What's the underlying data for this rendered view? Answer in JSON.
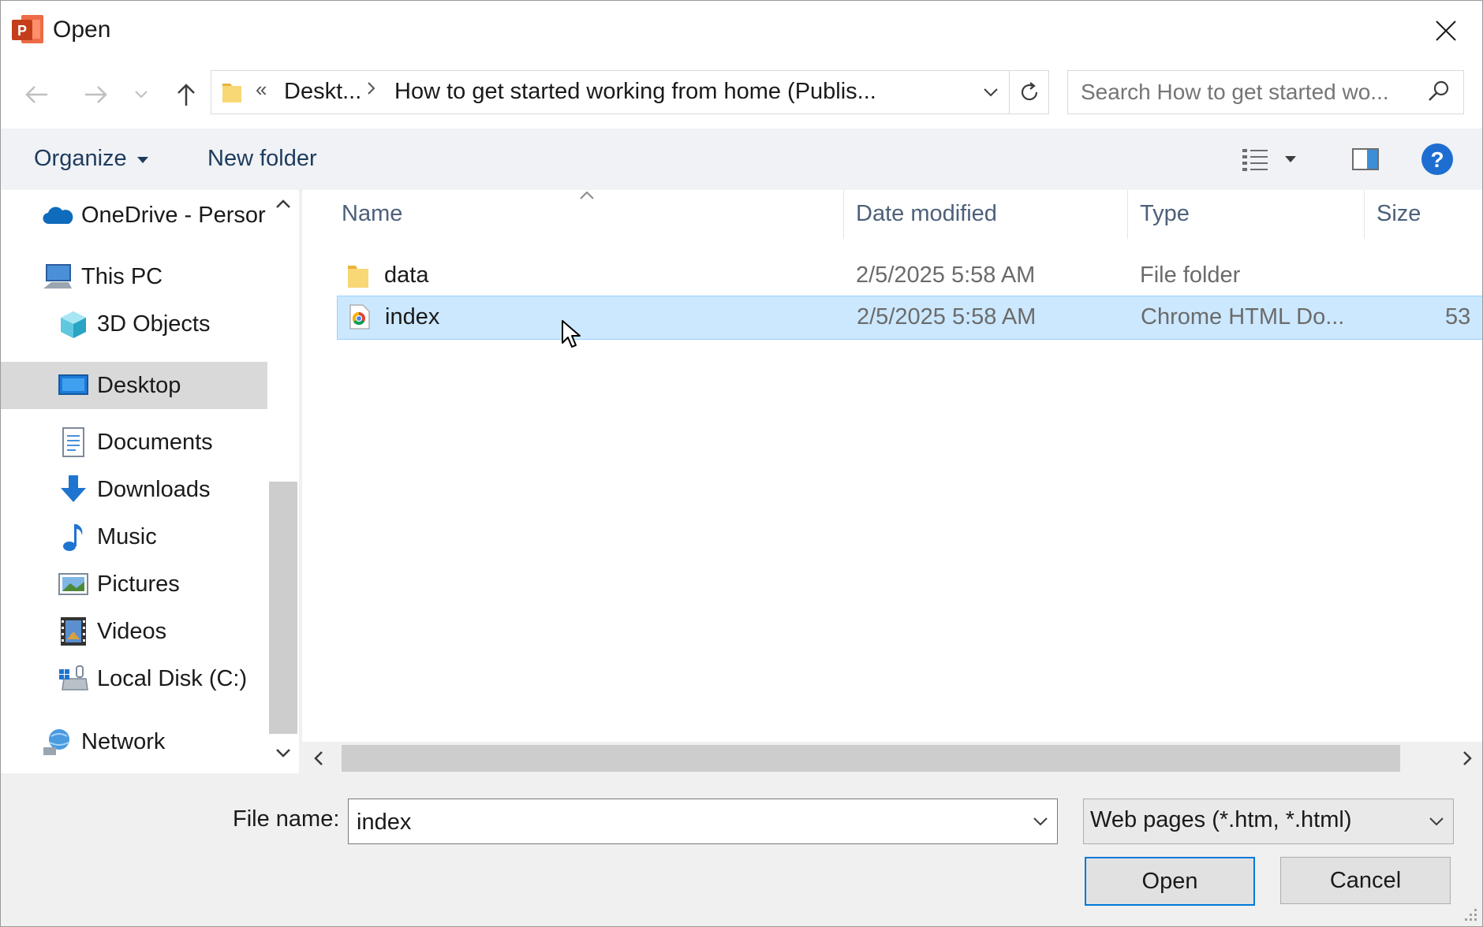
{
  "window": {
    "title": "Open"
  },
  "nav": {
    "address_overflow": "«",
    "breadcrumb": [
      "Deskt...",
      "How to get started working from home (Publis..."
    ],
    "search_placeholder": "Search How to get started wo..."
  },
  "toolbar": {
    "organize_label": "Organize",
    "new_folder_label": "New folder"
  },
  "sidebar": {
    "items": [
      {
        "label": "OneDrive - Persor",
        "icon": "onedrive-icon"
      },
      {
        "label": "This PC",
        "icon": "computer-icon"
      },
      {
        "label": "3D Objects",
        "icon": "3d-objects-icon"
      },
      {
        "label": "Desktop",
        "icon": "desktop-icon",
        "selected": true
      },
      {
        "label": "Documents",
        "icon": "documents-icon"
      },
      {
        "label": "Downloads",
        "icon": "downloads-icon"
      },
      {
        "label": "Music",
        "icon": "music-icon"
      },
      {
        "label": "Pictures",
        "icon": "pictures-icon"
      },
      {
        "label": "Videos",
        "icon": "videos-icon"
      },
      {
        "label": "Local Disk (C:)",
        "icon": "local-disk-icon"
      },
      {
        "label": "Network",
        "icon": "network-icon"
      }
    ]
  },
  "file_list": {
    "columns": [
      "Name",
      "Date modified",
      "Type",
      "Size"
    ],
    "rows": [
      {
        "name": "data",
        "date": "2/5/2025 5:58 AM",
        "type": "File folder",
        "size": "",
        "icon": "folder-icon"
      },
      {
        "name": "index",
        "date": "2/5/2025 5:58 AM",
        "type": "Chrome HTML Do...",
        "size": "53",
        "icon": "chrome-html-icon",
        "selected": true
      }
    ]
  },
  "footer": {
    "file_name_label": "File name:",
    "file_name_value": "index",
    "file_type": "Web pages (*.htm, *.html)",
    "open_label": "Open",
    "cancel_label": "Cancel"
  },
  "colors": {
    "accent": "#0078d7",
    "selection": "#cce8ff",
    "selection_border": "#99d1ff",
    "ppt_brand": "#d24726"
  }
}
